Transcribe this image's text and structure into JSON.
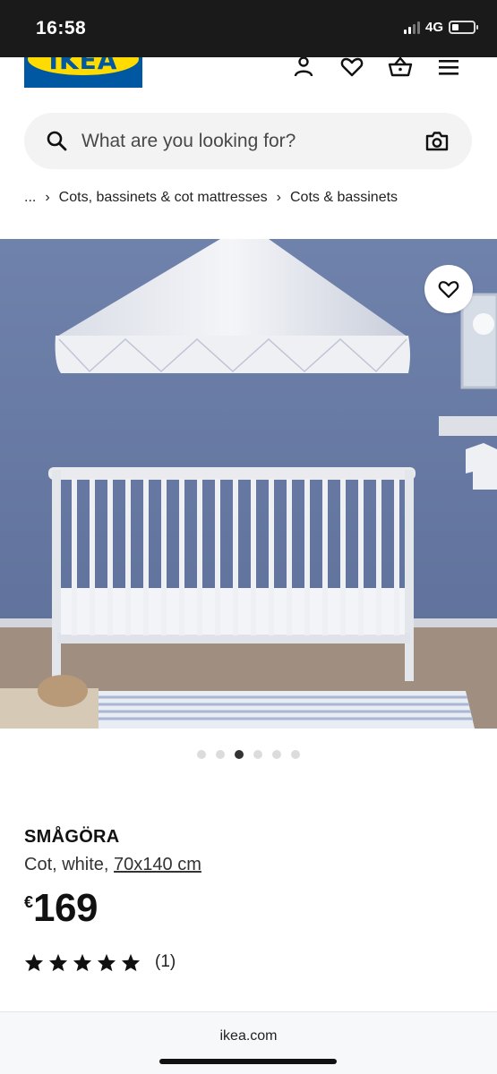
{
  "status_bar": {
    "time": "16:58",
    "network": "4G",
    "battery_level": 0.3
  },
  "header": {
    "logo_text": "IKEA",
    "icons": [
      "profile-icon",
      "heart-icon",
      "basket-icon",
      "menu-icon"
    ]
  },
  "search": {
    "placeholder": "What are you looking for?",
    "icon": "search-icon",
    "camera_icon": "camera-icon"
  },
  "breadcrumb": {
    "ellipsis": "...",
    "items": [
      "Cots, bassinets & cot mattresses",
      "Cots & bassinets"
    ]
  },
  "gallery": {
    "image_count": 6,
    "active_index": 2
  },
  "product": {
    "name": "SMÅGÖRA",
    "description_prefix": "Cot, white, ",
    "size_link": "70x140 cm",
    "currency": "€",
    "price": "169",
    "rating_stars": 5,
    "review_count": "(1)"
  },
  "footer": {
    "domain": "ikea.com"
  },
  "colors": {
    "ikea_blue": "#0058a3",
    "ikea_yellow": "#ffdb00"
  }
}
